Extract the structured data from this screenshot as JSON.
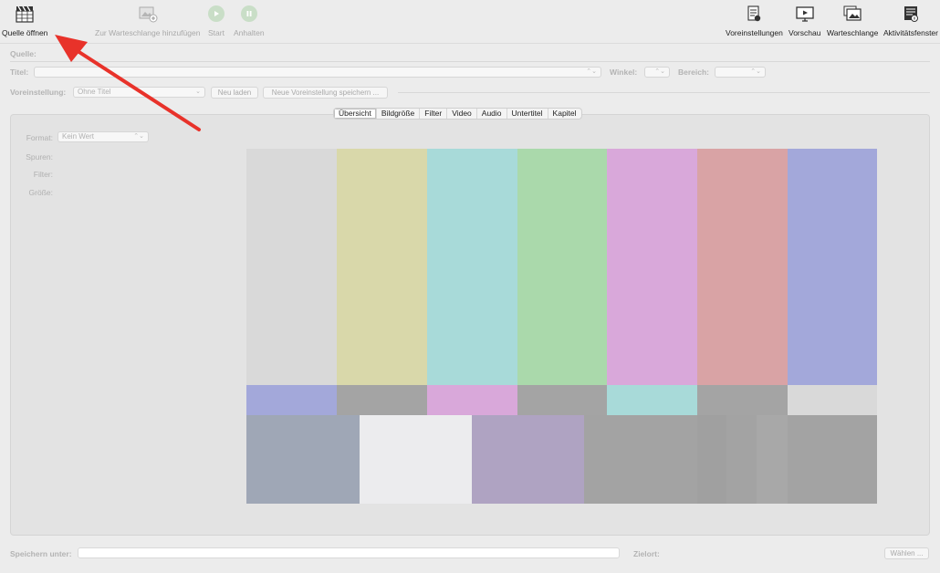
{
  "toolbar": {
    "open_source": "Quelle öffnen",
    "add_to_queue": "Zur Warteschlange hinzufügen",
    "start": "Start",
    "pause": "Anhalten",
    "presets": "Voreinstellungen",
    "preview": "Vorschau",
    "queue": "Warteschlange",
    "activity": "Aktivitätsfenster"
  },
  "source": {
    "label": "Quelle:"
  },
  "title_row": {
    "label": "Titel:",
    "angle_label": "Winkel:",
    "range_label": "Bereich:"
  },
  "preset_row": {
    "label": "Voreinstellung:",
    "value": "Ohne Titel",
    "reload": "Neu laden",
    "save_new": "Neue Voreinstellung speichern ..."
  },
  "tabs": [
    {
      "label": "Übersicht",
      "active": true
    },
    {
      "label": "Bildgröße"
    },
    {
      "label": "Filter"
    },
    {
      "label": "Video"
    },
    {
      "label": "Audio"
    },
    {
      "label": "Untertitel"
    },
    {
      "label": "Kapitel"
    }
  ],
  "summary": {
    "format_label": "Format:",
    "format_value": "Kein Wert",
    "tracks_label": "Spuren:",
    "filters_label": "Filter:",
    "size_label": "Größe:"
  },
  "bottom": {
    "save_as_label": "Speichern unter:",
    "destination_label": "Zielort:",
    "choose_button": "Wählen ..."
  },
  "colors": {
    "bar_gray": "#d9d9d9",
    "bar_yellow": "#d9d8aa",
    "bar_cyan": "#a8dad9",
    "bar_green": "#aad9ab",
    "bar_magenta": "#d9a8da",
    "bar_red": "#d9a3a5",
    "bar_blue": "#a3a8da",
    "arrow": "#e8322a"
  }
}
